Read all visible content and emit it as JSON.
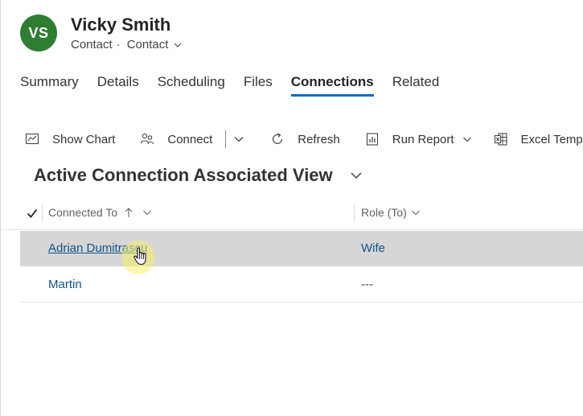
{
  "record": {
    "initials": "VS",
    "name": "Vicky Smith",
    "entity_type": "Contact",
    "separator": "·",
    "form_name": "Contact",
    "avatar_color": "#2e7d32"
  },
  "tabs": [
    {
      "label": "Summary",
      "active": false
    },
    {
      "label": "Details",
      "active": false
    },
    {
      "label": "Scheduling",
      "active": false
    },
    {
      "label": "Files",
      "active": false
    },
    {
      "label": "Connections",
      "active": true
    },
    {
      "label": "Related",
      "active": false
    }
  ],
  "commands": {
    "show_chart": "Show Chart",
    "connect": "Connect",
    "refresh": "Refresh",
    "run_report": "Run Report",
    "excel_templates": "Excel Templ"
  },
  "view": {
    "title": "Active Connection Associated View"
  },
  "grid": {
    "columns": [
      {
        "label": "Connected To",
        "sorted": "ascending"
      },
      {
        "label": "Role (To)"
      }
    ],
    "rows": [
      {
        "connected_to": "Adrian Dumitrascu",
        "role": "Wife",
        "selected": true
      },
      {
        "connected_to": "Martin",
        "role": "---",
        "selected": false
      }
    ]
  },
  "colors": {
    "accent": "#0f6cbd",
    "link": "#0f548c",
    "selected_row": "#d6d6d6",
    "cursor_highlight": "#faf06e"
  },
  "icons": [
    "chart-icon",
    "connect-icon",
    "chevron-down-icon",
    "refresh-icon",
    "report-icon",
    "excel-icon",
    "checkmark-icon",
    "sort-ascending-icon",
    "hand-cursor-icon"
  ]
}
